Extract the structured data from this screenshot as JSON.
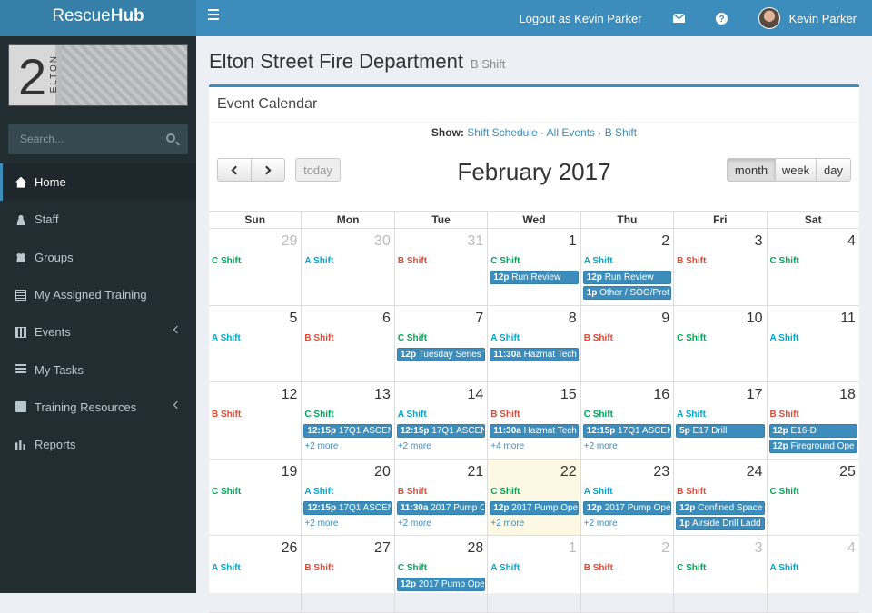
{
  "app": {
    "logo_light": "Rescue",
    "logo_bold": "Hub"
  },
  "topnav": {
    "logout": "Logout as Kevin Parker",
    "user_name": "Kevin Parker"
  },
  "sidebar": {
    "banner_number": "2",
    "banner_text": "ELTON",
    "search_placeholder": "Search...",
    "items": [
      {
        "label": "Home",
        "icon": "home-icon"
      },
      {
        "label": "Staff",
        "icon": "user-icon"
      },
      {
        "label": "Groups",
        "icon": "users-icon"
      },
      {
        "label": "My Assigned Training",
        "icon": "document-icon"
      },
      {
        "label": "Events",
        "icon": "calendar-icon"
      },
      {
        "label": "My Tasks",
        "icon": "list-icon"
      },
      {
        "label": "Training Resources",
        "icon": "book-icon"
      },
      {
        "label": "Reports",
        "icon": "bar-chart-icon"
      }
    ]
  },
  "page": {
    "title": "Elton Street Fire Department",
    "subtitle": "B Shift"
  },
  "calendar": {
    "box_title": "Event Calendar",
    "show_label": "Show:",
    "filters": [
      "Shift Schedule",
      "All Events",
      "B Shift"
    ],
    "today_label": "today",
    "views": [
      "month",
      "week",
      "day"
    ],
    "month_title": "February 2017",
    "weekdays": [
      "Sun",
      "Mon",
      "Tue",
      "Wed",
      "Thu",
      "Fri",
      "Sat"
    ],
    "colors": {
      "A Shift": "#00a7d0",
      "B Shift": "#dd4b39",
      "C Shift": "#00a65a",
      "event": "#3c8dbc",
      "today": "#fcf8e3"
    },
    "weeks": [
      [
        {
          "day": "29",
          "other": true,
          "shift": "C Shift",
          "events": []
        },
        {
          "day": "30",
          "other": true,
          "shift": "A Shift",
          "events": []
        },
        {
          "day": "31",
          "other": true,
          "shift": "B Shift",
          "events": []
        },
        {
          "day": "1",
          "shift": "C Shift",
          "events": [
            {
              "time": "12p",
              "title": "Run Review"
            }
          ]
        },
        {
          "day": "2",
          "shift": "A Shift",
          "events": [
            {
              "time": "12p",
              "title": "Run Review"
            },
            {
              "time": "1p",
              "title": "Other / SOG/Prot"
            }
          ]
        },
        {
          "day": "3",
          "shift": "B Shift",
          "events": []
        },
        {
          "day": "4",
          "shift": "C Shift",
          "events": []
        }
      ],
      [
        {
          "day": "5",
          "shift": "A Shift",
          "events": []
        },
        {
          "day": "6",
          "shift": "B Shift",
          "events": []
        },
        {
          "day": "7",
          "shift": "C Shift",
          "events": [
            {
              "time": "12p",
              "title": "Tuesday Series"
            }
          ]
        },
        {
          "day": "8",
          "shift": "A Shift",
          "events": [
            {
              "time": "11:30a",
              "title": "Hazmat Tech"
            }
          ]
        },
        {
          "day": "9",
          "shift": "B Shift",
          "events": []
        },
        {
          "day": "10",
          "shift": "C Shift",
          "events": []
        },
        {
          "day": "11",
          "shift": "A Shift",
          "events": []
        }
      ],
      [
        {
          "day": "12",
          "shift": "B Shift",
          "events": []
        },
        {
          "day": "13",
          "shift": "C Shift",
          "events": [
            {
              "time": "12:15p",
              "title": "17Q1 ASCEN"
            }
          ],
          "more": "+2 more"
        },
        {
          "day": "14",
          "shift": "A Shift",
          "events": [
            {
              "time": "12:15p",
              "title": "17Q1 ASCEN"
            }
          ],
          "more": "+2 more"
        },
        {
          "day": "15",
          "shift": "B Shift",
          "events": [
            {
              "time": "11:30a",
              "title": "Hazmat Tech"
            }
          ],
          "more": "+4 more"
        },
        {
          "day": "16",
          "shift": "C Shift",
          "events": [
            {
              "time": "12:15p",
              "title": "17Q1 ASCEN"
            }
          ],
          "more": "+2 more"
        },
        {
          "day": "17",
          "shift": "A Shift",
          "events": [
            {
              "time": "5p",
              "title": "E17 Drill"
            }
          ]
        },
        {
          "day": "18",
          "shift": "B Shift",
          "events": [
            {
              "time": "12p",
              "title": "E16-D"
            },
            {
              "time": "12p",
              "title": "Fireground Ope"
            }
          ]
        }
      ],
      [
        {
          "day": "19",
          "shift": "C Shift",
          "events": []
        },
        {
          "day": "20",
          "shift": "A Shift",
          "events": [
            {
              "time": "12:15p",
              "title": "17Q1 ASCEN"
            }
          ],
          "more": "+2 more"
        },
        {
          "day": "21",
          "shift": "B Shift",
          "events": [
            {
              "time": "11:30a",
              "title": "2017 Pump O"
            }
          ],
          "more": "+2 more"
        },
        {
          "day": "22",
          "today": true,
          "shift": "C Shift",
          "events": [
            {
              "time": "12p",
              "title": "2017 Pump Ope"
            }
          ],
          "more": "+2 more"
        },
        {
          "day": "23",
          "shift": "A Shift",
          "events": [
            {
              "time": "12p",
              "title": "2017 Pump Ope"
            }
          ],
          "more": "+2 more"
        },
        {
          "day": "24",
          "shift": "B Shift",
          "events": [
            {
              "time": "12p",
              "title": "Confined Space"
            },
            {
              "time": "1p",
              "title": "Airside Drill Ladd"
            }
          ]
        },
        {
          "day": "25",
          "shift": "C Shift",
          "events": []
        }
      ],
      [
        {
          "day": "26",
          "shift": "A Shift",
          "events": []
        },
        {
          "day": "27",
          "shift": "B Shift",
          "events": []
        },
        {
          "day": "28",
          "shift": "C Shift",
          "events": [
            {
              "time": "12p",
              "title": "2017 Pump Ope"
            }
          ]
        },
        {
          "day": "1",
          "other": true,
          "shift": "A Shift",
          "events": []
        },
        {
          "day": "2",
          "other": true,
          "shift": "B Shift",
          "events": []
        },
        {
          "day": "3",
          "other": true,
          "shift": "C Shift",
          "events": []
        },
        {
          "day": "4",
          "other": true,
          "shift": "A Shift",
          "events": []
        }
      ]
    ]
  }
}
